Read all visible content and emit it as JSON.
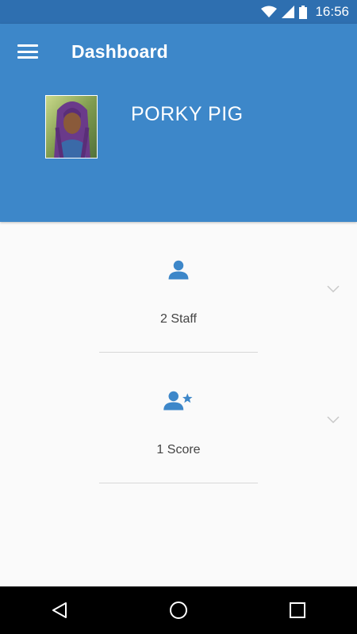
{
  "status_bar": {
    "time": "16:56"
  },
  "header": {
    "title": "Dashboard"
  },
  "profile": {
    "name": "PORKY PIG"
  },
  "cards": [
    {
      "label": "2 Staff",
      "icon": "person-icon"
    },
    {
      "label": "1 Score",
      "icon": "person-star-icon"
    }
  ],
  "colors": {
    "status_bar": "#2e6fb0",
    "app_bar": "#3d87c9",
    "icon_accent": "#3d87c9",
    "background": "#fafafa"
  }
}
